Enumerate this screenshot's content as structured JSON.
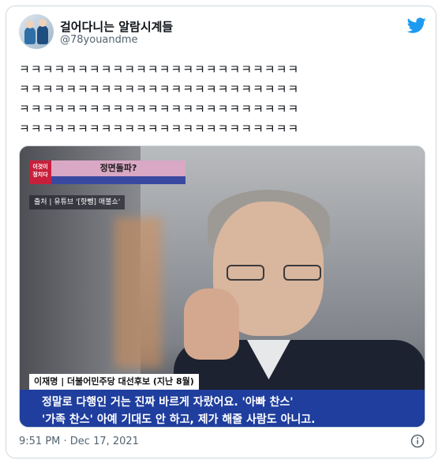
{
  "tweet": {
    "display_name": "걸어다니는 알람시계들",
    "handle": "@78youandme",
    "text_lines": [
      "ㅋㅋㅋㅋㅋㅋㅋㅋㅋㅋㅋㅋㅋㅋㅋㅋㅋㅋㅋㅋㅋㅋㅋㅋ",
      "ㅋㅋㅋㅋㅋㅋㅋㅋㅋㅋㅋㅋㅋㅋㅋㅋㅋㅋㅋㅋㅋㅋㅋㅋ",
      "ㅋㅋㅋㅋㅋㅋㅋㅋㅋㅋㅋㅋㅋㅋㅋㅋㅋㅋㅋㅋㅋㅋㅋㅋ",
      "ㅋㅋㅋㅋㅋㅋㅋㅋㅋㅋㅋㅋㅋㅋㅋㅋㅋㅋㅋㅋㅋㅋㅋㅋ"
    ],
    "timestamp": "9:51 PM · Dec 17, 2021"
  },
  "media": {
    "badge_text": "이것이 정치다",
    "title_banner": "정면돌파?",
    "source_label": "출처 | 유튜브 '[핫뼁] 매불쇼'",
    "speaker_label": "이재명 | 더불어민주당 대선후보 (지난 8월)",
    "subtitle_line1": "정말로 다행인 거는 진짜 바르게 자랐어요. '아빠 찬스'",
    "subtitle_line2": "'가족 찬스' 아예 기대도 안 하고, 제가 해줄 사람도 아니고."
  },
  "icons": {
    "brand": "twitter-bird-icon",
    "info": "info-icon"
  },
  "colors": {
    "twitter_blue": "#1d9bf0",
    "caption_blue": "#1f3e9e",
    "badge_red": "#c8203c"
  }
}
